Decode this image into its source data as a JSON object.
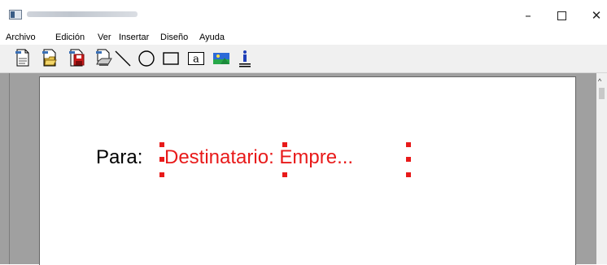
{
  "menu": {
    "items": [
      "Archivo",
      "Edición",
      "Ver",
      "Insertar",
      "Diseño",
      "Ayuda"
    ]
  },
  "toolbar": {
    "tools": [
      "new-document-icon",
      "open-folder-icon",
      "save-disk-icon",
      "print-icon",
      "line-tool-icon",
      "ellipse-tool-icon",
      "rectangle-tool-icon",
      "text-tool-icon",
      "image-tool-icon",
      "field-info-icon"
    ]
  },
  "document": {
    "label_text": "Para:",
    "field_text": "Destinatario: Empre..."
  },
  "colors": {
    "field_text": "#e81a1a",
    "workspace": "#a0a0a0",
    "toolbar": "#f0f0f0"
  }
}
